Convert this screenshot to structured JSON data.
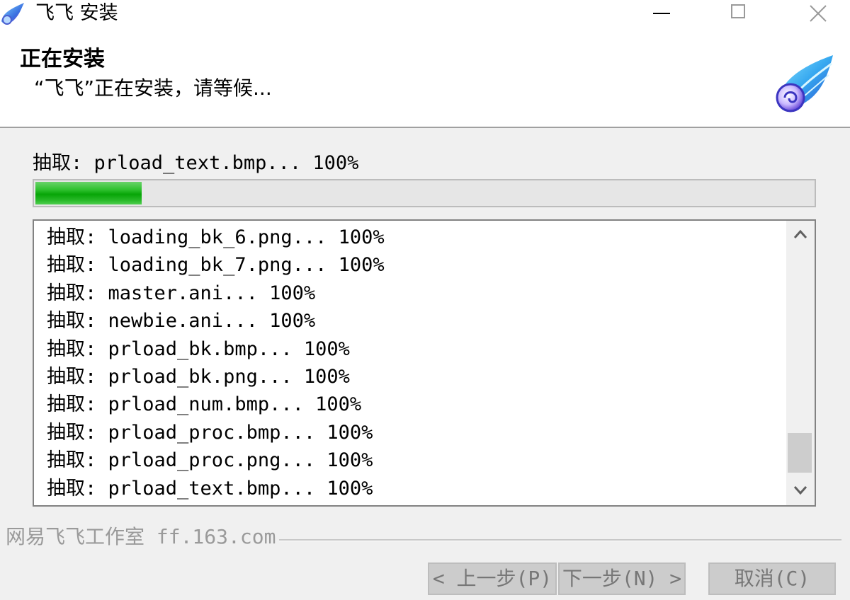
{
  "window": {
    "title": "飞飞 安装",
    "icon": "wing-logo-icon",
    "controls": [
      "minimize-icon",
      "maximize-icon",
      "close-icon"
    ]
  },
  "header": {
    "title": "正在安装",
    "subtitle": "“飞飞”正在安装，请等候..."
  },
  "status": {
    "text": "抽取: prload_text.bmp... 100%"
  },
  "progress": {
    "fraction": 0.137,
    "color": "#07a507"
  },
  "log": {
    "items": [
      "抽取: loading_bk_6.png... 100%",
      "抽取: loading_bk_7.png... 100%",
      "抽取: master.ani... 100%",
      "抽取: newbie.ani... 100%",
      "抽取: prload_bk.bmp... 100%",
      "抽取: prload_bk.png... 100%",
      "抽取: prload_num.bmp... 100%",
      "抽取: prload_proc.bmp... 100%",
      "抽取: prload_proc.png... 100%",
      "抽取: prload_text.bmp... 100%"
    ]
  },
  "footer": {
    "brand": "网易飞飞工作室 ff.163.com",
    "buttons": {
      "back": "< 上一步(P)",
      "next": "下一步(N) >",
      "cancel": "取消(C)"
    }
  }
}
